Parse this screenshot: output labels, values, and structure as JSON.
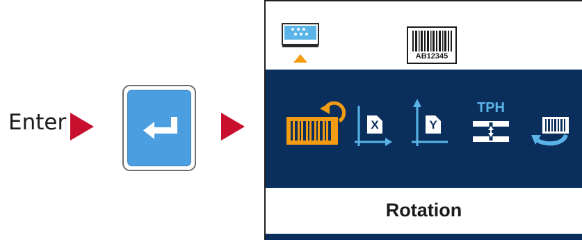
{
  "instruction": {
    "enter_label": "Enter"
  },
  "keys": {
    "enter_key_icon": "enter-return-icon"
  },
  "colors": {
    "arrow": "#c8102e",
    "key_fill": "#4b9fe0",
    "band": "#0a2f5c",
    "highlight": "#f39c12"
  },
  "screen": {
    "top_tabs": [
      {
        "icon": "printer-panel-icon",
        "selected": true
      },
      {
        "icon": "barcode-label-icon",
        "selected": false
      }
    ],
    "barcode_caption": "AB12345",
    "tph_caption": "TPH",
    "axis_x_letter": "X",
    "axis_y_letter": "Y",
    "menu_items": [
      {
        "icon": "rotation-icon",
        "selected": true
      },
      {
        "icon": "x-offset-icon",
        "selected": false
      },
      {
        "icon": "y-offset-icon",
        "selected": false
      },
      {
        "icon": "tph-adjust-icon",
        "selected": false
      },
      {
        "icon": "reprint-icon",
        "selected": false
      }
    ],
    "selected_label": "Rotation"
  }
}
